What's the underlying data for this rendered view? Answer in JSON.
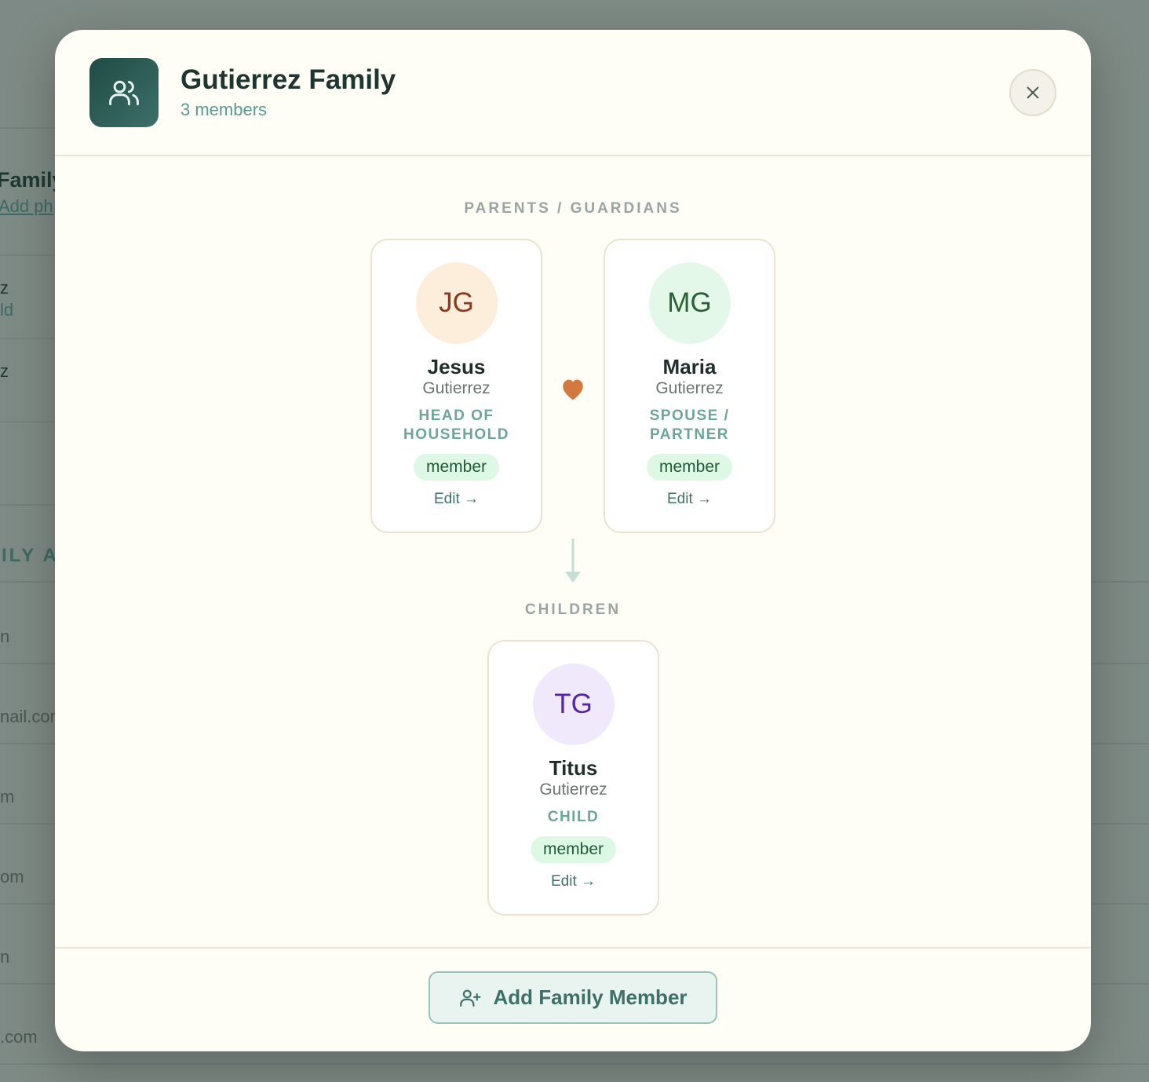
{
  "background": {
    "title": "Family",
    "link": "Add ph",
    "row1_line1": "z",
    "row1_line2": "ld",
    "row2": "z",
    "section": "ILY A",
    "items": [
      "n",
      "nail.com",
      "m",
      "om",
      "n",
      ".com"
    ]
  },
  "header": {
    "title": "Gutierrez Family",
    "subtitle": "3 members",
    "icon": "users-icon",
    "close_icon": "close-icon"
  },
  "sections": {
    "parents": "PARENTS / GUARDIANS",
    "children": "CHILDREN"
  },
  "members": [
    {
      "initials": "JG",
      "first": "Jesus",
      "last": "Gutierrez",
      "role": "HEAD OF HOUSEHOLD",
      "badge": "member",
      "edit": "Edit →",
      "avatar_bg": "#fdeedc",
      "avatar_fg": "#8c3a1f"
    },
    {
      "initials": "MG",
      "first": "Maria",
      "last": "Gutierrez",
      "role": "SPOUSE / PARTNER",
      "badge": "member",
      "edit": "Edit →",
      "avatar_bg": "#e3f8e9",
      "avatar_fg": "#2b5f35"
    },
    {
      "initials": "TG",
      "first": "Titus",
      "last": "Gutierrez",
      "role": "CHILD",
      "badge": "member",
      "edit": "Edit →",
      "avatar_bg": "#efe9fb",
      "avatar_fg": "#5425a6"
    }
  ],
  "footer": {
    "add_button": "Add Family Member",
    "add_icon": "user-plus-icon"
  },
  "colors": {
    "accent": "#3d7068",
    "heart": "#d2793f"
  }
}
